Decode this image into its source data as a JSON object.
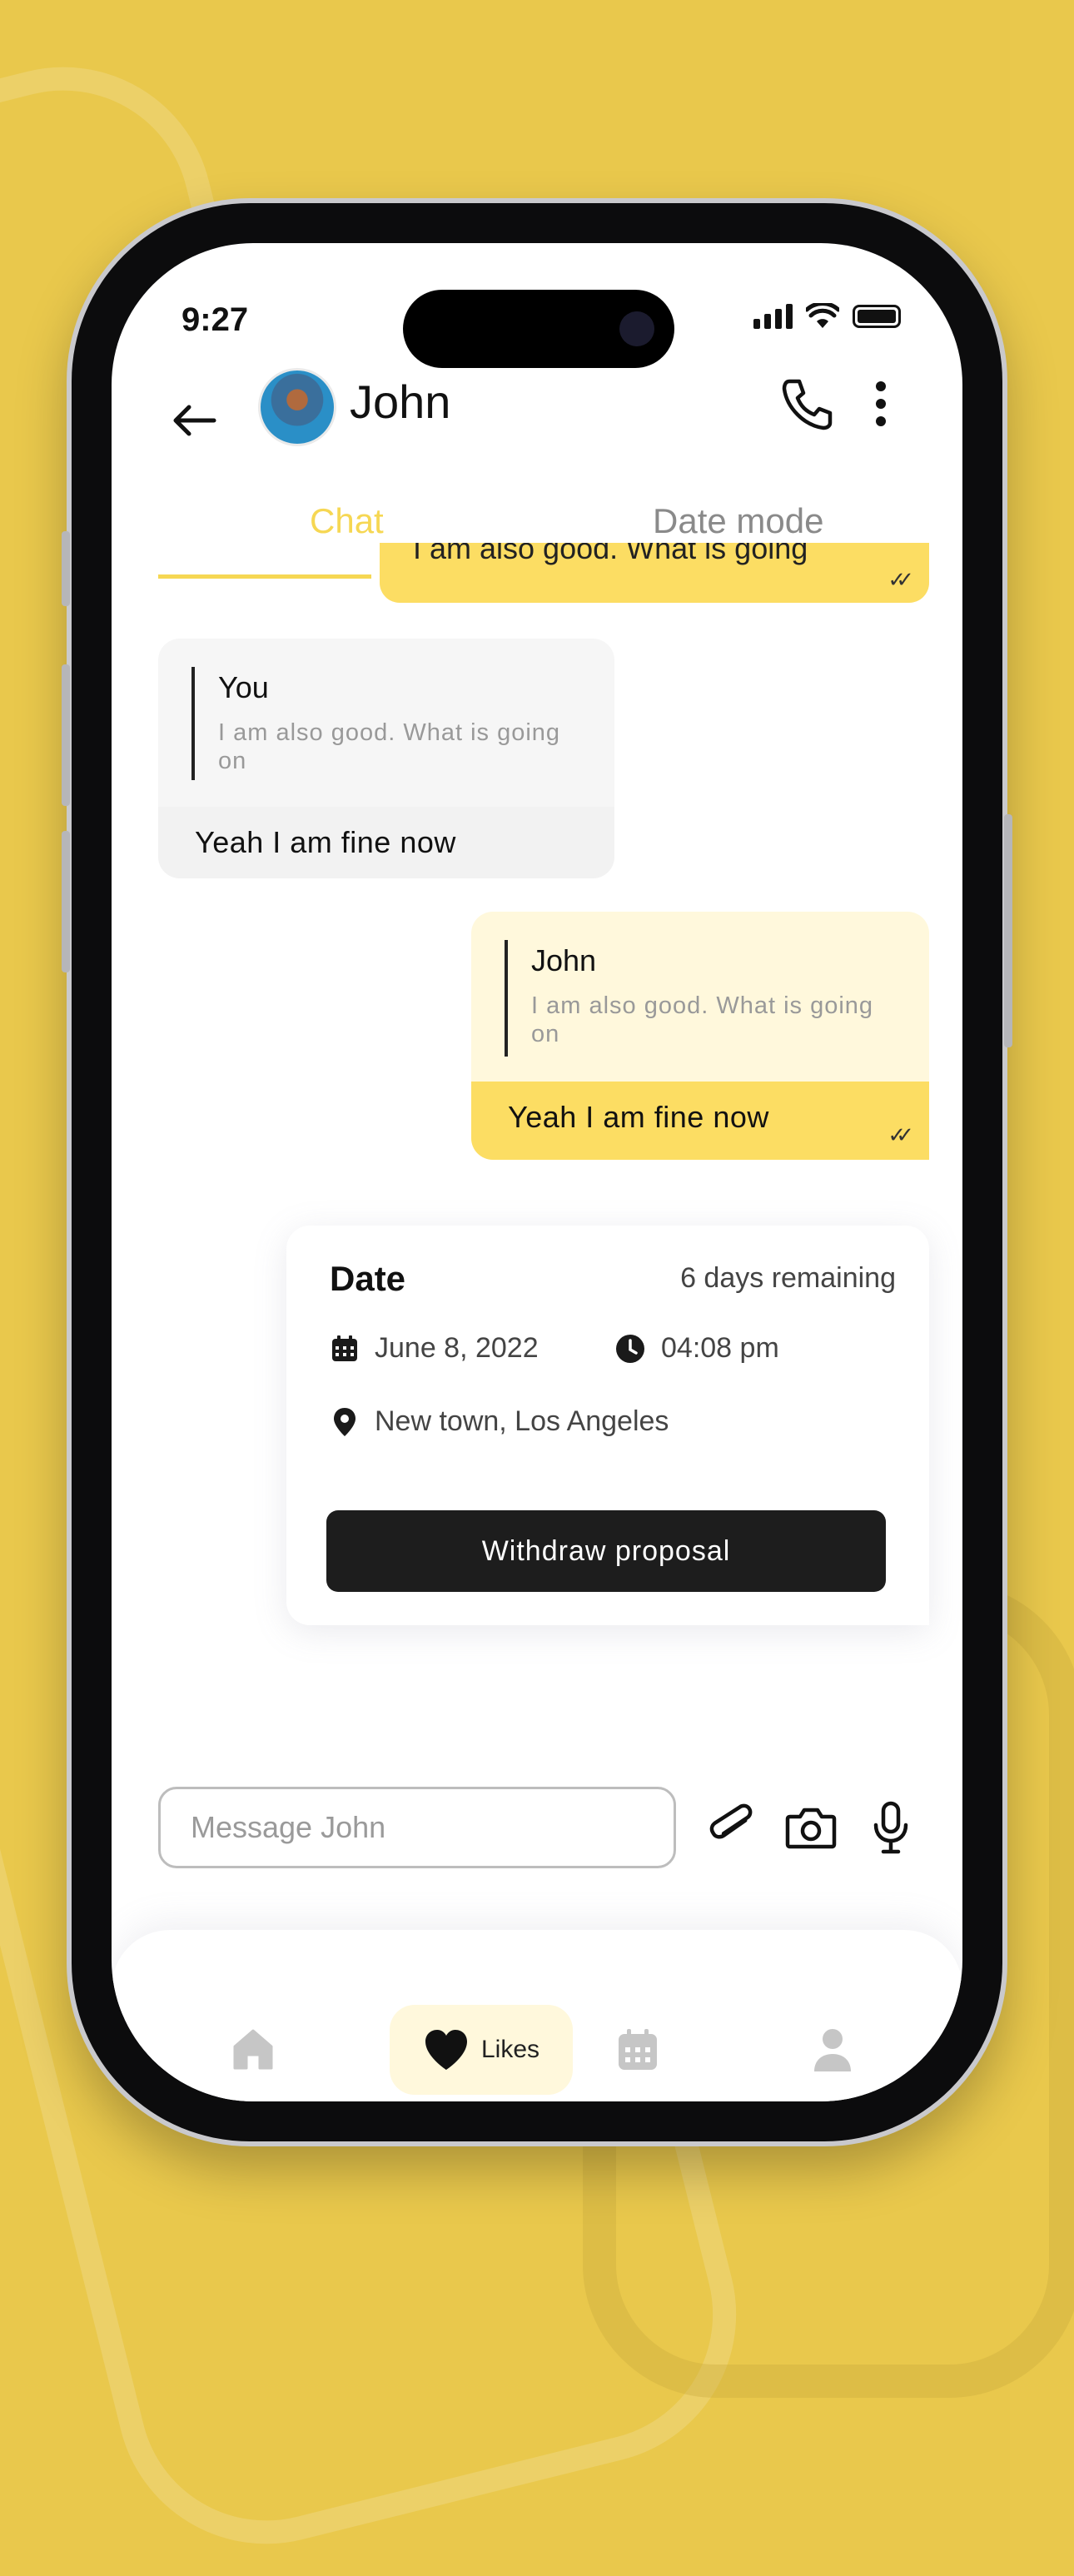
{
  "status_bar": {
    "time": "9:27"
  },
  "header": {
    "contact_name": "John"
  },
  "tabs": [
    {
      "label": "Chat",
      "active": true
    },
    {
      "label": "Date mode",
      "active": false
    }
  ],
  "messages": {
    "partial_out": {
      "text": "I am also good. What is going"
    },
    "incoming": {
      "reply_author": "You",
      "reply_text": "I am also good. What is going on",
      "text": "Yeah I am fine now"
    },
    "outgoing": {
      "reply_author": "John",
      "reply_text": "I am also good. What is going on",
      "text": "Yeah I am fine now"
    }
  },
  "date_card": {
    "title": "Date",
    "remaining": "6 days remaining",
    "date": "June 8, 2022",
    "time": "04:08 pm",
    "location": "New town, Los Angeles",
    "button_label": "Withdraw proposal"
  },
  "composer": {
    "placeholder": "Message John"
  },
  "bottom_nav": {
    "items": [
      {
        "icon": "home-icon",
        "active": false
      },
      {
        "icon": "heart-icon",
        "label": "Likes",
        "active": true
      },
      {
        "icon": "calendar-icon",
        "active": false
      },
      {
        "icon": "profile-icon",
        "active": false
      }
    ]
  },
  "colors": {
    "accent": "#fcdd63",
    "accent_light": "#fff8dc",
    "background": "#e9c84c",
    "dark_button": "#1d1d1d"
  }
}
